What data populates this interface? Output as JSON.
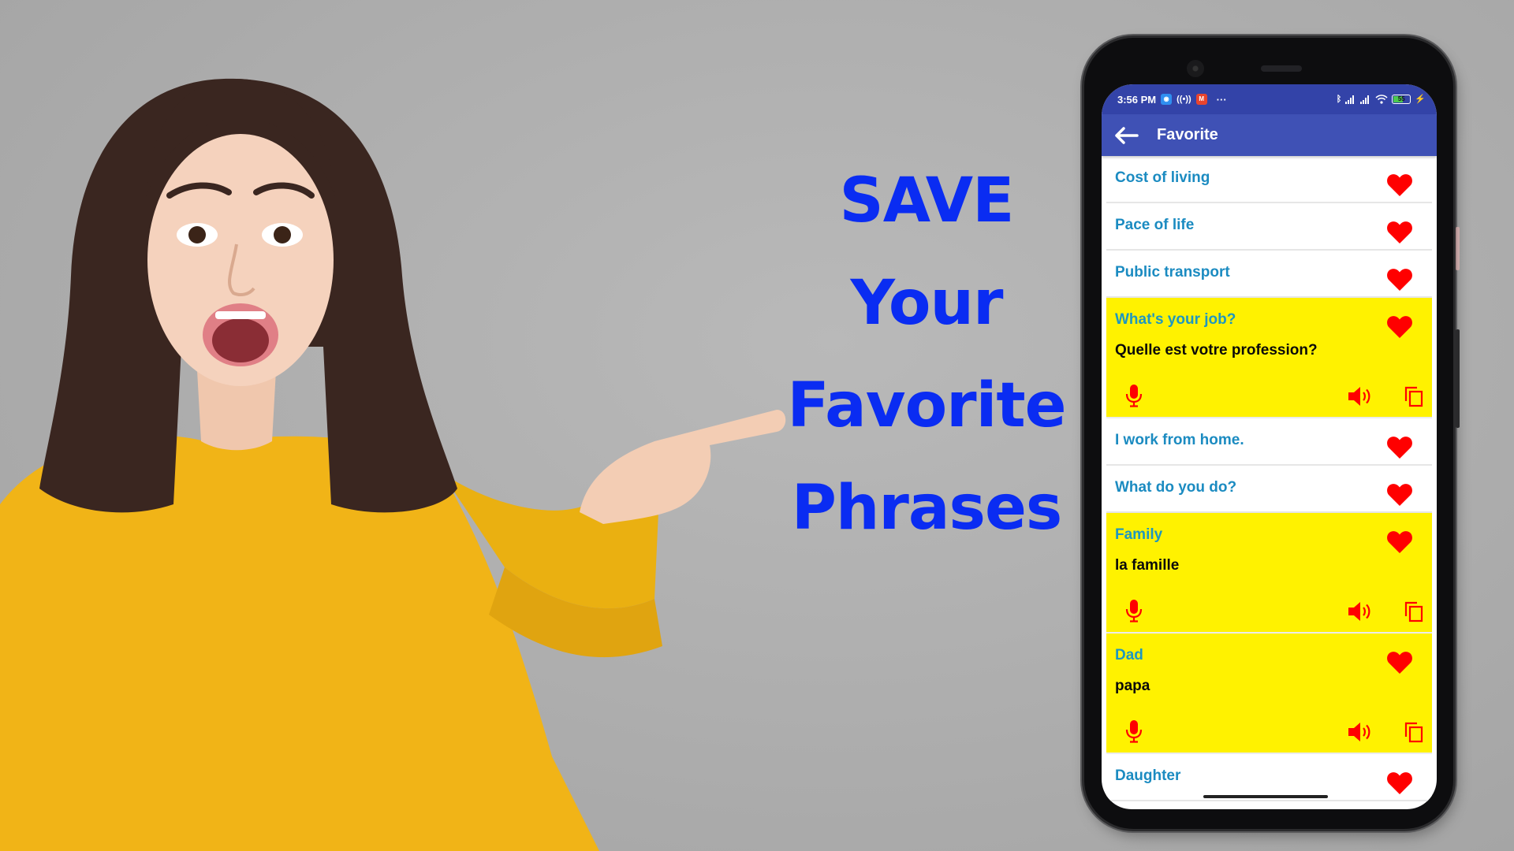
{
  "promo": {
    "headline_lines": [
      "SAVE",
      "Your",
      "Favorite",
      "Phrases"
    ],
    "headline_color": "#0a2cf2",
    "illustration": "surprised woman in yellow sweater pointing right"
  },
  "status_bar": {
    "time": "3:56 PM",
    "overflow": "···",
    "battery_level": "55",
    "icons": [
      "app-notification-icon",
      "hotspot-icon",
      "app-notification-icon",
      "bluetooth-icon",
      "signal-icon",
      "signal-icon",
      "wifi-icon",
      "battery-icon",
      "charging-icon"
    ]
  },
  "app_bar": {
    "title": "Favorite",
    "back_icon": "arrow-left-icon",
    "color": "#3f51b5"
  },
  "favorites": [
    {
      "phrase": "Cost of living",
      "expanded": false
    },
    {
      "phrase": "Pace of life",
      "expanded": false
    },
    {
      "phrase": "Public transport",
      "expanded": false
    },
    {
      "phrase": "What's your job?",
      "translation": "Quelle est votre profession?",
      "expanded": true
    },
    {
      "phrase": "I work from home.",
      "expanded": false
    },
    {
      "phrase": "What do you do?",
      "expanded": false
    },
    {
      "phrase": "Family",
      "translation": "la famille",
      "expanded": true
    },
    {
      "phrase": "Dad",
      "translation": "papa",
      "expanded": true
    },
    {
      "phrase": "Daughter",
      "expanded": false
    }
  ],
  "colors": {
    "phrase_text": "#1b8bc1",
    "expanded_bg": "#fff200",
    "icon_red": "#ff0000"
  }
}
